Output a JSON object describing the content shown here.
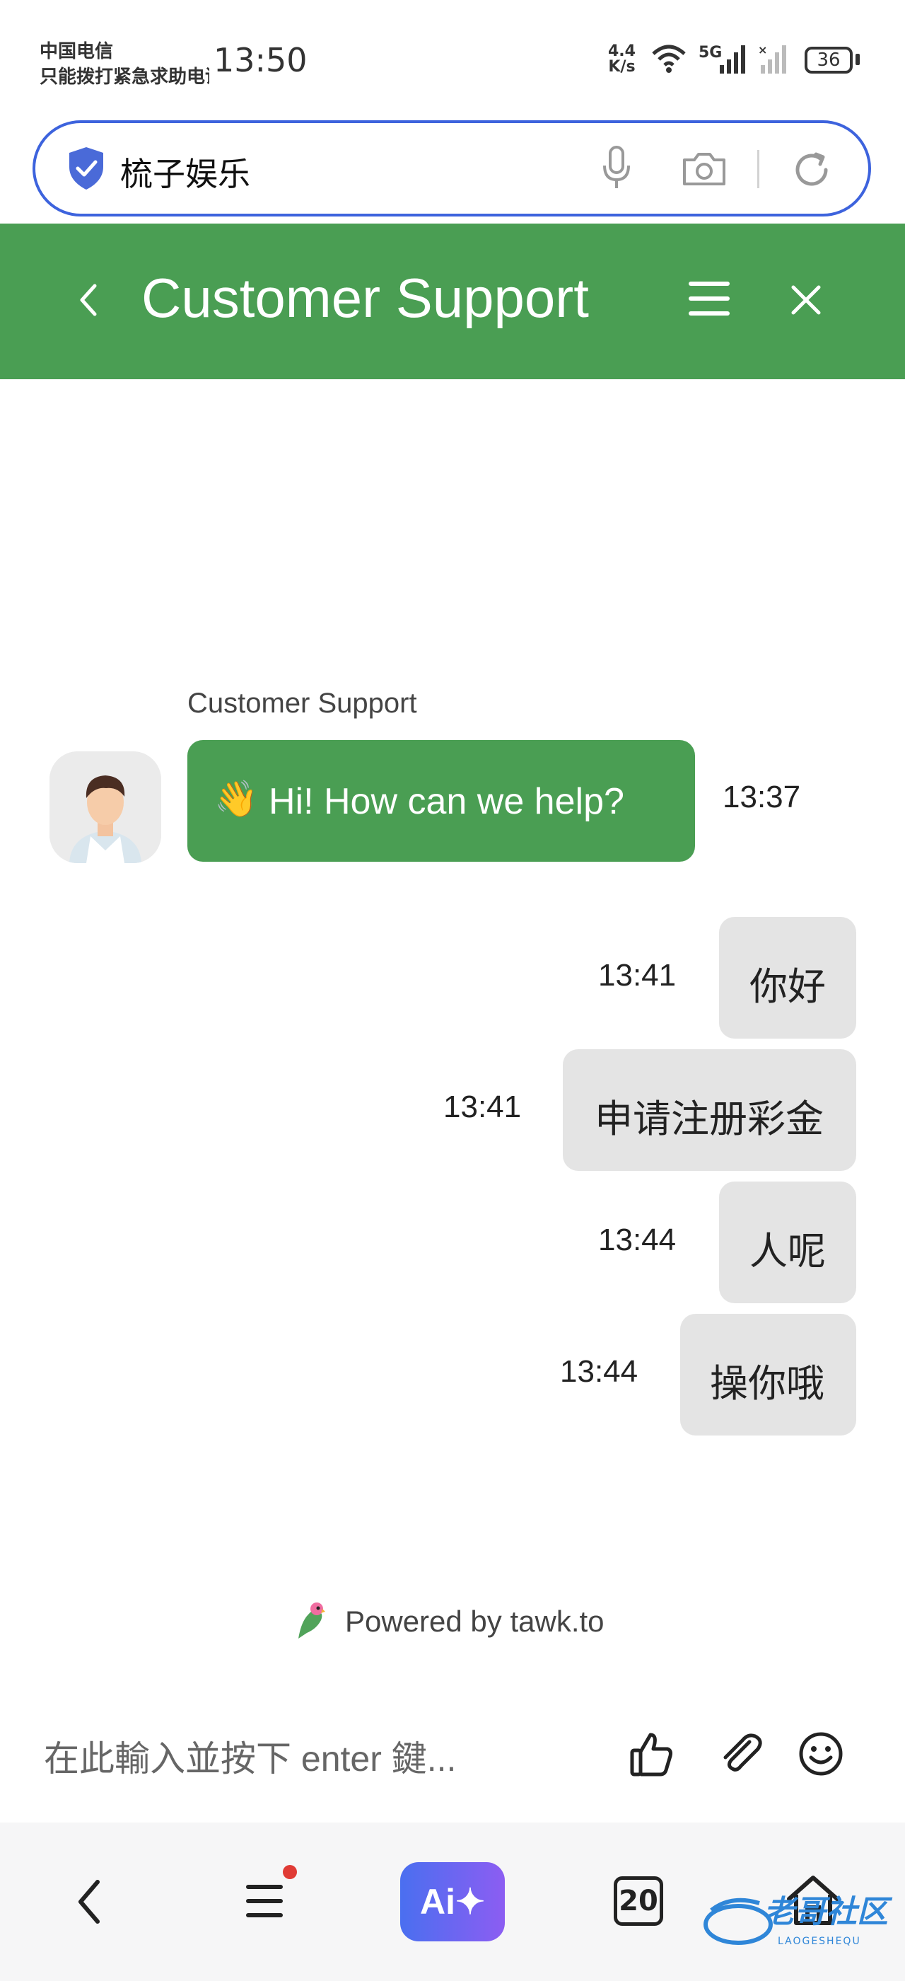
{
  "status_bar": {
    "carrier_line1": "中国电信",
    "carrier_line2": "只能拨打紧急求助电话",
    "time": "13:50",
    "net_speed_value": "4.4",
    "net_speed_unit": "K/s",
    "signal_label": "5G",
    "battery": "36"
  },
  "browser": {
    "url_text": "梳子娱乐",
    "icons": [
      "shield-check-icon",
      "microphone-icon",
      "camera-icon",
      "refresh-icon"
    ]
  },
  "chat_header": {
    "title": "Customer Support",
    "icons": [
      "back-chevron-icon",
      "menu-icon",
      "close-icon"
    ],
    "color": "#4a9e53"
  },
  "messages": [
    {
      "sender": "agent",
      "name": "Customer Support",
      "emoji": "👋",
      "text": "Hi! How can we help?",
      "time": "13:37"
    },
    {
      "sender": "visitor",
      "text": "你好",
      "time": "13:41"
    },
    {
      "sender": "visitor",
      "text": "申请注册彩金",
      "time": "13:41"
    },
    {
      "sender": "visitor",
      "text": "人呢",
      "time": "13:44"
    },
    {
      "sender": "visitor",
      "text": "操你哦",
      "time": "13:44"
    }
  ],
  "footer": {
    "powered_by": "Powered by tawk.to"
  },
  "composer": {
    "placeholder": "在此輸入並按下 enter 鍵...",
    "icons": [
      "thumbs-up-icon",
      "paperclip-icon",
      "smiley-icon"
    ]
  },
  "bottom_nav": {
    "ai_label": "Ai✦",
    "tab_count": "20",
    "watermark": "老哥社区",
    "watermark_sub": "LAOGESHEQU"
  }
}
